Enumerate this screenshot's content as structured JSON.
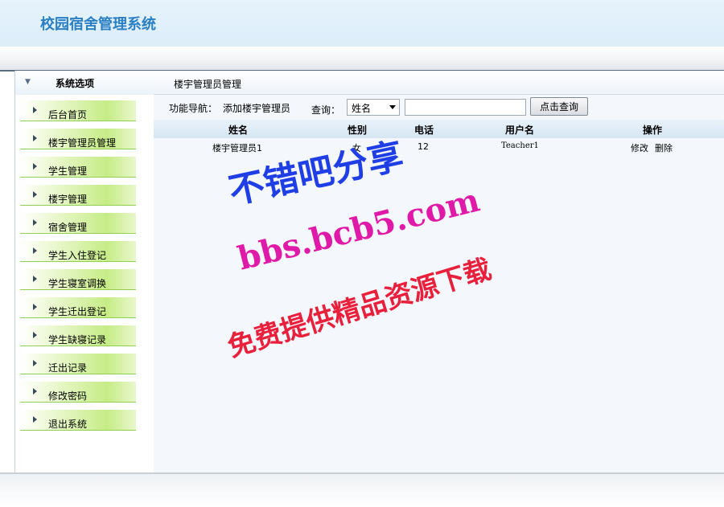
{
  "app": {
    "title": "校园宿舍管理系统"
  },
  "sidebar": {
    "header": "系统选项",
    "items": [
      {
        "label": "后台首页"
      },
      {
        "label": "楼宇管理员管理"
      },
      {
        "label": "学生管理"
      },
      {
        "label": "楼宇管理"
      },
      {
        "label": "宿舍管理"
      },
      {
        "label": "学生入住登记"
      },
      {
        "label": "学生寝室调换"
      },
      {
        "label": "学生迁出登记"
      },
      {
        "label": "学生缺寝记录"
      },
      {
        "label": "迁出记录"
      },
      {
        "label": "修改密码"
      },
      {
        "label": "退出系统"
      }
    ]
  },
  "main": {
    "title": "楼宇管理员管理",
    "nav_label": "功能导航：",
    "nav_link": "添加楼宇管理员",
    "query_label": "查询：",
    "query_field": "姓名",
    "query_value": "",
    "search_button": "点击查询",
    "table": {
      "columns": [
        "姓名",
        "性别",
        "电话",
        "用户名",
        "操作"
      ],
      "rows": [
        {
          "name": "楼宇管理员1",
          "gender": "女",
          "phone": "12",
          "username": "Teacher1",
          "edit": "修改",
          "delete": "删除"
        }
      ]
    }
  },
  "watermark": {
    "line1": "不错吧分享",
    "line2": "bbs.bcb5.com",
    "line3": "免费提供精品资源下载"
  }
}
